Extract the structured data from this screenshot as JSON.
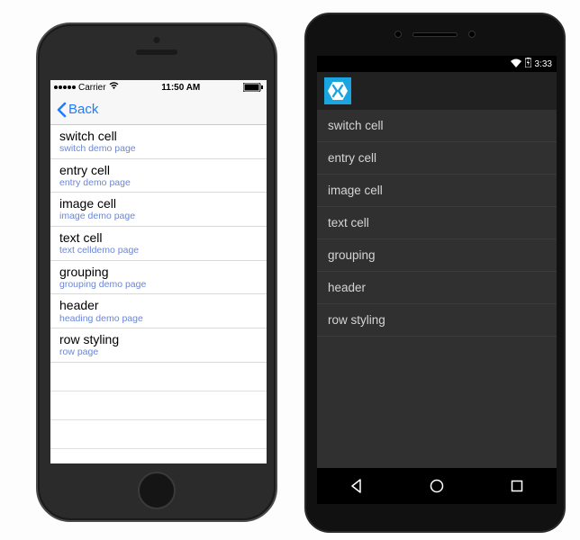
{
  "ios": {
    "status": {
      "carrier": "Carrier",
      "time": "11:50 AM"
    },
    "nav": {
      "back_label": "Back"
    },
    "cells": [
      {
        "title": "switch cell",
        "sub": "switch demo page"
      },
      {
        "title": "entry cell",
        "sub": "entry demo page"
      },
      {
        "title": "image cell",
        "sub": "image demo page"
      },
      {
        "title": "text cell",
        "sub": "text celldemo page"
      },
      {
        "title": "grouping",
        "sub": "grouping demo page"
      },
      {
        "title": "header",
        "sub": "heading demo page"
      },
      {
        "title": "row styling",
        "sub": "row page"
      }
    ]
  },
  "android": {
    "status": {
      "time": "3:33"
    },
    "cells": [
      {
        "title": "switch cell"
      },
      {
        "title": "entry cell"
      },
      {
        "title": "image cell"
      },
      {
        "title": "text cell"
      },
      {
        "title": "grouping"
      },
      {
        "title": "header"
      },
      {
        "title": "row styling"
      }
    ]
  }
}
